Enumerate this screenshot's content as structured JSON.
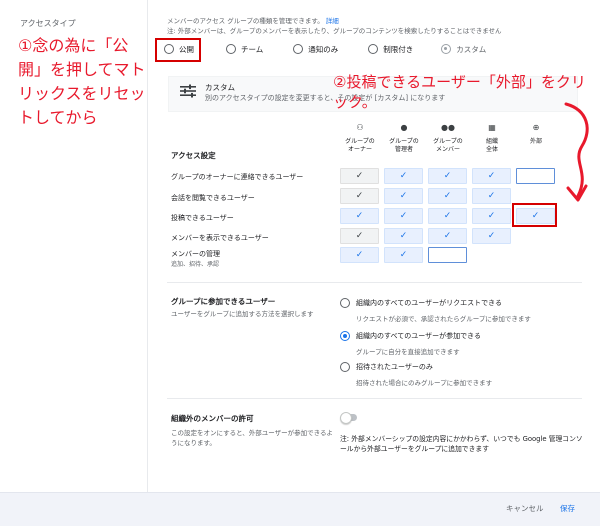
{
  "sidebar": {
    "title": "アクセスタイプ"
  },
  "header": {
    "description": "メンバーのアクセス グループの種類を管理できます。",
    "link": "詳細",
    "note": "注: 外部メンバーは、グループのメンバーを表示したり、グループのコンテンツを検索したりすることはできません"
  },
  "access_types": [
    {
      "label": "公開"
    },
    {
      "label": "チーム"
    },
    {
      "label": "通知のみ"
    },
    {
      "label": "制限付き"
    },
    {
      "label": "カスタム"
    }
  ],
  "annotations": {
    "step1": "①念の為に「公開」を押してマトリックスをリセットしてから",
    "step2": "②投稿できるユーザー「外部」をクリック。"
  },
  "custom": {
    "title": "カスタム",
    "description": "別のアクセスタイプの設定を変更すると、その設定が [カスタム] になります"
  },
  "matrix": {
    "section_label": "アクセス設定",
    "columns": [
      {
        "icon": "person-outline-icon",
        "glyph": "⚇",
        "label1": "グループの",
        "label2": "オーナー"
      },
      {
        "icon": "person-icon",
        "glyph": "●",
        "label1": "グループの",
        "label2": "管理者"
      },
      {
        "icon": "group-icon",
        "glyph": "●●",
        "label1": "グループの",
        "label2": "メンバー"
      },
      {
        "icon": "domain-icon",
        "glyph": "▦",
        "label1": "組織",
        "label2": "全体"
      },
      {
        "icon": "globe-icon",
        "glyph": "⊕",
        "label1": "外部",
        "label2": ""
      }
    ],
    "rows": [
      {
        "label": "グループのオーナーに連絡できるユーザー",
        "sub": "",
        "cells": [
          "grey",
          "on",
          "on",
          "on",
          "empty"
        ]
      },
      {
        "label": "会話を閲覧できるユーザー",
        "sub": "",
        "cells": [
          "grey",
          "on",
          "on",
          "on",
          "none"
        ]
      },
      {
        "label": "投稿できるユーザー",
        "sub": "",
        "cells": [
          "on",
          "on",
          "on",
          "on",
          "on"
        ]
      },
      {
        "label": "メンバーを表示できるユーザー",
        "sub": "",
        "cells": [
          "grey",
          "on",
          "on",
          "on",
          "none"
        ]
      },
      {
        "label": "メンバーの管理",
        "sub": "追加、招待、承認",
        "cells": [
          "on",
          "on",
          "empty",
          "none",
          "none"
        ]
      }
    ],
    "check_glyph": "✓"
  },
  "join": {
    "title": "グループに参加できるユーザー",
    "description": "ユーザーをグループに追加する方法を選択します",
    "options": [
      {
        "title": "組織内のすべてのユーザーがリクエストできる",
        "sub": "リクエストが必須で、承認されたらグループに参加できます"
      },
      {
        "title": "組織内のすべてのユーザーが参加できる",
        "sub": "グループに自分を直接追加できます"
      },
      {
        "title": "招待されたユーザーのみ",
        "sub": "招待された場合にのみグループに参加できます"
      }
    ]
  },
  "external": {
    "title": "組織外のメンバーの許可",
    "description": "この設定をオンにすると、外部ユーザーが参加できるようになります。",
    "note": "注: 外部メンバーシップの設定内容にかかわらず、いつでも Google 管理コンソールから外部ユーザーをグループに追加できます"
  },
  "footer": {
    "cancel": "キャンセル",
    "save": "保存"
  },
  "colors": {
    "accent": "#1a73e8",
    "annotation": "#e8192c",
    "highlight_border": "#d50000"
  }
}
